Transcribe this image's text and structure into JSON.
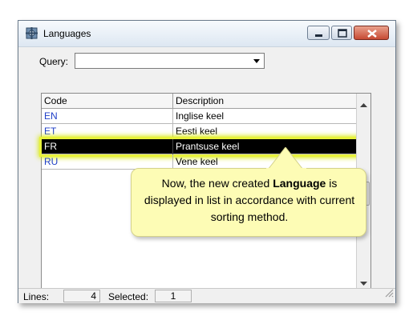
{
  "window": {
    "title": "Languages",
    "icon": "languages-app-icon"
  },
  "query": {
    "label": "Query:",
    "value": "",
    "placeholder": ""
  },
  "table": {
    "headers": {
      "code": "Code",
      "description": "Description"
    },
    "rows": [
      {
        "code": "EN",
        "description": "Inglise keel"
      },
      {
        "code": "ET",
        "description": "Eesti keel"
      },
      {
        "code": "FR",
        "description": "Prantsuse keel"
      },
      {
        "code": "RU",
        "description": "Vene keel"
      }
    ],
    "selected_index": 2
  },
  "callout": {
    "before": "Now, the new created ",
    "bold": "Language",
    "after": " is displayed in list in accordance with current sorting method."
  },
  "status": {
    "lines_label": "Lines:",
    "lines_value": "4",
    "selected_label": "Selected:",
    "selected_value": "1"
  },
  "colors": {
    "code_text": "#1f3fc7",
    "selection": "#000000",
    "highlight_glow": "#e8f23a",
    "callout_bg": "#fdfcb5"
  }
}
